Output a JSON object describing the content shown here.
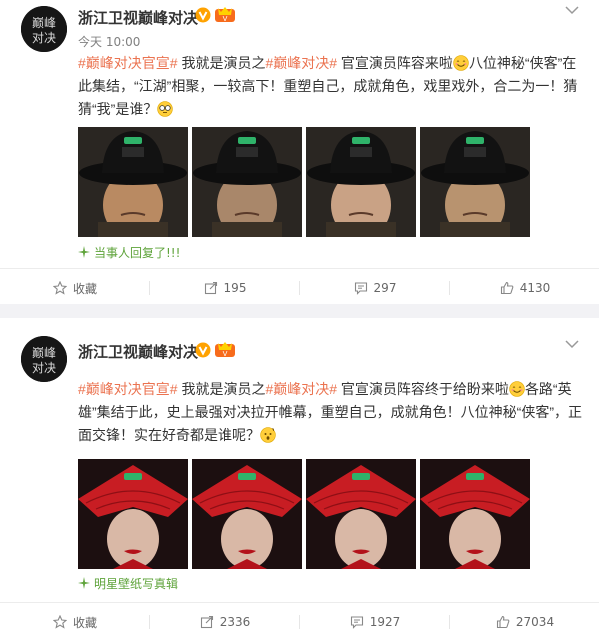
{
  "posts": [
    {
      "author": "浙江卫视巅峰对决",
      "time": "今天 10:00",
      "text_runs": [
        {
          "t": "#巅峰对决官宣#",
          "tag": true
        },
        {
          "t": " 我就是演员之",
          "tag": false
        },
        {
          "t": "#巅峰对决#",
          "tag": true
        },
        {
          "t": " 官宣演员阵容来啦",
          "tag": false
        },
        {
          "emoji": "smile-emoji"
        },
        {
          "t": "八位神秘“侠客”在此集结，“江湖”相聚，一较高下！重塑自己，成就角色，戏里戏外，合二为一！猜猜“我”是谁？",
          "tag": false
        },
        {
          "emoji": "glasses-emoji"
        }
      ],
      "image_theme": "black-hat",
      "sub_link": "当事人回复了!!!",
      "actions": {
        "fav": "收藏",
        "repost": "195",
        "comment": "297",
        "like": "4130"
      }
    },
    {
      "author": "浙江卫视巅峰对决",
      "time": "今天 10:00",
      "text_runs": [
        {
          "t": "#巅峰对决官宣#",
          "tag": true
        },
        {
          "t": " 我就是演员之",
          "tag": false
        },
        {
          "t": "#巅峰对决#",
          "tag": true
        },
        {
          "t": " 官宣演员阵容终于给盼来啦",
          "tag": false
        },
        {
          "emoji": "smile-emoji"
        },
        {
          "t": "各路“英雄”集结于此，史上最强对决拉开帷幕，重塑自己，成就角色！八位神秘“侠客”，正面交锋！实在好奇都是谁呢？",
          "tag": false
        },
        {
          "emoji": "wonder-emoji"
        }
      ],
      "image_theme": "red-hat",
      "sub_link": "明星壁纸写真辑",
      "actions": {
        "fav": "收藏",
        "repost": "2336",
        "comment": "1927",
        "like": "27034"
      }
    }
  ],
  "colors": {
    "tag": "#eb7350",
    "sub_link": "#5ea33a",
    "verified": "#ffa200"
  }
}
